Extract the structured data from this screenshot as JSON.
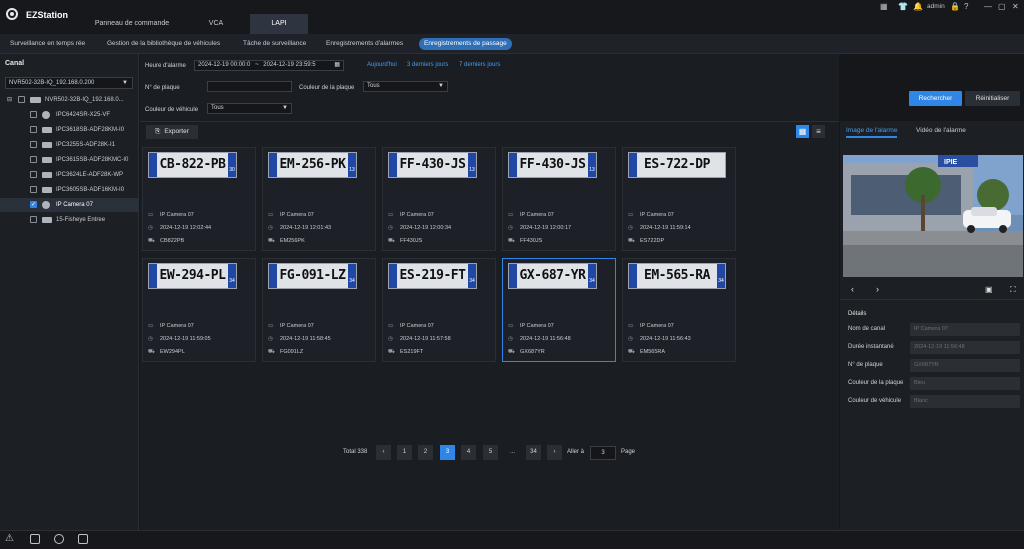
{
  "app": {
    "name": "EZStation"
  },
  "main_tabs": [
    "Panneau de commande",
    "VCA",
    "LAPI"
  ],
  "topbar": {
    "user": "admin"
  },
  "sub_tabs": [
    "Surveillance en temps rée",
    "Gestion de la bibliothèque de véhicules",
    "Tâche de surveillance",
    "Enregistrements d'alarmes",
    "Enregistrements de passage"
  ],
  "sidebar": {
    "title": "Canal",
    "nvr_select": "NVR502-32B-IQ_192.168.0.200",
    "root": "NVR502-32B-IQ_192.168.0...",
    "items": [
      {
        "label": "IPC6424SR-X25-VF",
        "checked": false,
        "icon": "dome-camera-icon"
      },
      {
        "label": "IPC3618SB-ADF28KM-I0",
        "checked": false,
        "icon": "bullet-camera-icon"
      },
      {
        "label": "IPC3255S-ADF28K-I1",
        "checked": false,
        "icon": "bullet-camera-icon"
      },
      {
        "label": "IPC3615SB-ADF28KMC-I0",
        "checked": false,
        "icon": "bullet-camera-icon"
      },
      {
        "label": "IPC3624LE-ADF28K-WP",
        "checked": false,
        "icon": "bullet-camera-icon"
      },
      {
        "label": "IPC3605SB-ADF16KM-I0",
        "checked": false,
        "icon": "bullet-camera-icon"
      },
      {
        "label": "IP Camera 07",
        "checked": true,
        "icon": "dome-camera-icon"
      },
      {
        "label": "15-Fisheye Entree",
        "checked": false,
        "icon": "bullet-camera-icon"
      }
    ]
  },
  "filters": {
    "time_label": "Heure d'alarme",
    "time_start": "2024-12-19 00:00:0",
    "time_sep": "~",
    "time_end": "2024-12-19 23:59:5",
    "quick": [
      "Aujourd'hui",
      "3 derniers jours",
      "7 derniers jours"
    ],
    "plate_label": "N° de plaque",
    "plate_value": "",
    "plate_color_label": "Couleur de la plaque",
    "plate_color_value": "Tous",
    "vehicle_color_label": "Couleur de véhicule",
    "vehicle_color_value": "Tous",
    "search_btn": "Rechercher",
    "reset_btn": "Réinitialiser"
  },
  "toolbar": {
    "export": "Exporter"
  },
  "records": [
    {
      "plate": "CB-822-PB",
      "dept": "30",
      "camera": "IP Camera 07",
      "time": "2024-12-19 12:02:44",
      "plate_code": "CB822PB"
    },
    {
      "plate": "EM-256-PK",
      "dept": "13",
      "camera": "IP Camera 07",
      "time": "2024-12-19 12:01:43",
      "plate_code": "EM256PK"
    },
    {
      "plate": "FF-430-JS",
      "dept": "13",
      "camera": "IP Camera 07",
      "time": "2024-12-19 12:00:34",
      "plate_code": "FF430JS"
    },
    {
      "plate": "FF-430-JS",
      "dept": "13",
      "camera": "IP Camera 07",
      "time": "2024-12-19 12:00:17",
      "plate_code": "FF430JS"
    },
    {
      "plate": "ES-722-DP",
      "dept": "",
      "camera": "IP Camera 07",
      "time": "2024-12-19 11:59:14",
      "plate_code": "ES722DP"
    },
    {
      "plate": "EW-294-PL",
      "dept": "34",
      "camera": "IP Camera 07",
      "time": "2024-12-19 11:59:05",
      "plate_code": "EW294PL"
    },
    {
      "plate": "FG-091-LZ",
      "dept": "34",
      "camera": "IP Camera 07",
      "time": "2024-12-19 11:58:45",
      "plate_code": "FG091LZ"
    },
    {
      "plate": "ES-219-FT",
      "dept": "34",
      "camera": "IP Camera 07",
      "time": "2024-12-19 11:57:58",
      "plate_code": "ES219FT"
    },
    {
      "plate": "GX-687-YR",
      "dept": "34",
      "camera": "IP Camera 07",
      "time": "2024-12-19 11:56:48",
      "plate_code": "GX687YR"
    },
    {
      "plate": "EM-565-RA",
      "dept": "34",
      "camera": "IP Camera 07",
      "time": "2024-12-19 11:56:43",
      "plate_code": "EM565RA"
    }
  ],
  "pagination": {
    "total": "Total 338",
    "pages": [
      "1",
      "2",
      "3",
      "4",
      "5",
      "...",
      "34"
    ],
    "current": "3",
    "goto_label": "Aller à",
    "goto_value": "3",
    "page_label": "Page"
  },
  "right_panel": {
    "tabs": [
      "Image de l'alarme",
      "Vidéo de l'alarme"
    ],
    "details_title": "Détails",
    "details": [
      {
        "label": "Nom de canal",
        "value": "IP Camera 07"
      },
      {
        "label": "Durée instantané",
        "value": "2024-12-19 11:56:48"
      },
      {
        "label": "N° de plaque",
        "value": "GX687YR"
      },
      {
        "label": "Couleur de la plaque",
        "value": "Bleu"
      },
      {
        "label": "Couleur de véhicule",
        "value": "Blanc"
      }
    ]
  }
}
